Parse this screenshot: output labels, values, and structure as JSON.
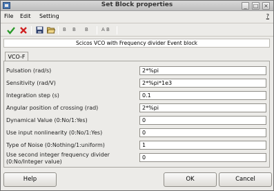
{
  "window": {
    "title": "Set Block properties"
  },
  "menu": {
    "file": "File",
    "edit": "Edit",
    "setting": "Setting",
    "help": "?"
  },
  "toolbar": {
    "label_a": "B",
    "label_b": "B",
    "label_c": "B",
    "label_d": "A B"
  },
  "description": "Scicos VCO with Frequency divider Event block",
  "tab": {
    "label": "VCO-F"
  },
  "fields": [
    {
      "label": "Pulsation (rad/s)",
      "value": "2*%pi"
    },
    {
      "label": "Sensitivity (rad/V)",
      "value": "2*%pi*1e3"
    },
    {
      "label": "Integration step (s)",
      "value": "0.1"
    },
    {
      "label": "Angular position of crossing (rad)",
      "value": "2*%pi"
    },
    {
      "label": "Dynamical Value (0:No/1:Yes)",
      "value": "0"
    },
    {
      "label": "Use input nonlinearity (0:No/1:Yes)",
      "value": "0"
    },
    {
      "label": "Type of Noise (0:Nothing/1:uniform)",
      "value": "1"
    },
    {
      "label": "Use second integer frequency divider",
      "label2": "(0:No/Integer value)",
      "value": "0"
    }
  ],
  "buttons": {
    "help": "Help",
    "ok": "OK",
    "cancel": "Cancel"
  }
}
